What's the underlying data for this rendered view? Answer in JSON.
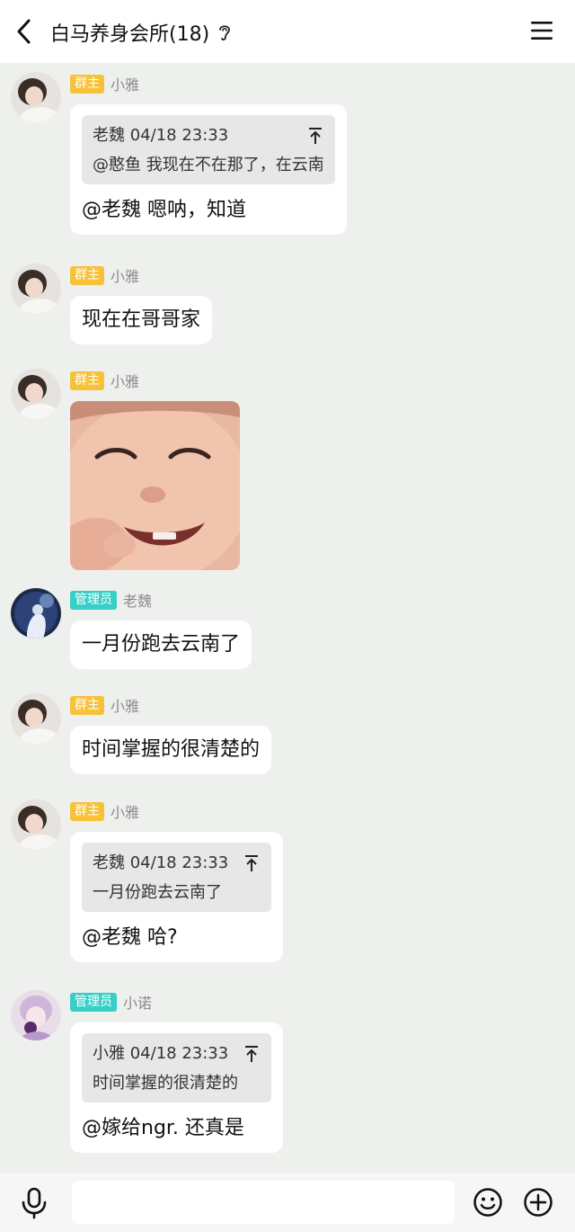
{
  "header": {
    "title": "白马养身会所(18)",
    "back_icon": "chevron-left-icon",
    "ear_icon": "ear-icon",
    "menu_icon": "hamburger-menu-icon"
  },
  "messages": [
    {
      "avatar": "avatar-xiaoya",
      "badge": "群主",
      "role": "owner",
      "nick": "小雅",
      "quote": {
        "head": "老魏 04/18 23:33",
        "body": "@憨鱼 我现在不在那了，在云南"
      },
      "text": "@老魏 嗯呐，知道"
    },
    {
      "avatar": "avatar-xiaoya",
      "badge": "群主",
      "role": "owner",
      "nick": "小雅",
      "text": "现在在哥哥家"
    },
    {
      "avatar": "avatar-xiaoya",
      "badge": "群主",
      "role": "owner",
      "nick": "小雅",
      "image": "laughing-baby-sticker"
    },
    {
      "avatar": "avatar-laowei",
      "badge": "管理员",
      "role": "admin",
      "nick": "老魏",
      "text": "一月份跑去云南了"
    },
    {
      "avatar": "avatar-xiaoya",
      "badge": "群主",
      "role": "owner",
      "nick": "小雅",
      "text": "时间掌握的很清楚的"
    },
    {
      "avatar": "avatar-xiaoya",
      "badge": "群主",
      "role": "owner",
      "nick": "小雅",
      "quote": {
        "head": "老魏 04/18 23:33",
        "body": "一月份跑去云南了"
      },
      "text": "@老魏 哈?"
    },
    {
      "avatar": "avatar-xiaonuo",
      "badge": "管理员",
      "role": "admin",
      "nick": "小诺",
      "quote": {
        "head": "小雅 04/18 23:33",
        "body": "时间掌握的很清楚的"
      },
      "text": "@嫁给ngr. 还真是"
    }
  ],
  "input_bar": {
    "mic_icon": "microphone-icon",
    "input_value": "",
    "emoji_icon": "emoji-icon",
    "plus_icon": "plus-circle-icon"
  },
  "colors": {
    "background": "#edf0ec",
    "owner_badge": "#f7c23a",
    "admin_badge": "#39cfc6",
    "bubble": "#ffffff",
    "quote_bg": "#e7e7e7"
  }
}
